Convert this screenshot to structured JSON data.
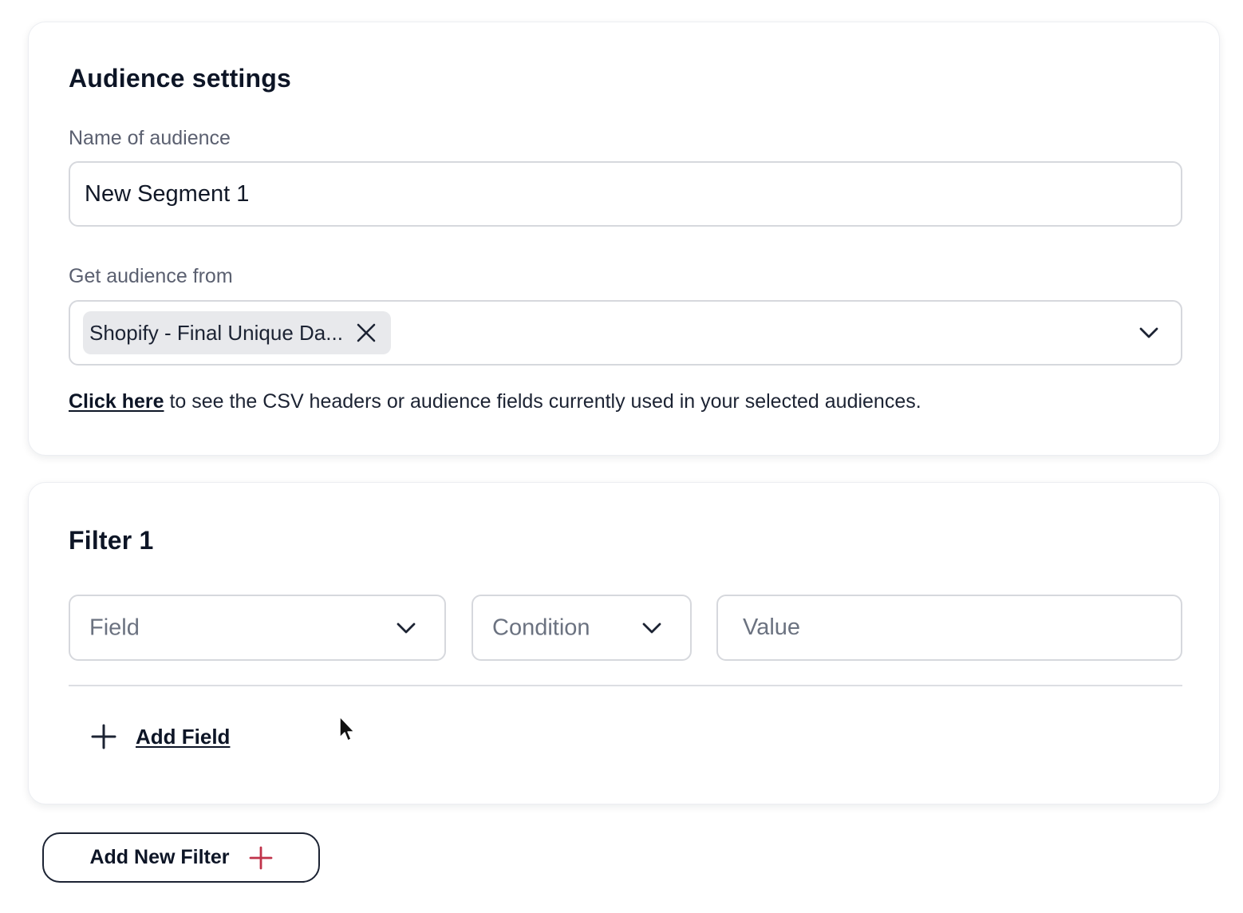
{
  "audience_settings": {
    "title": "Audience settings",
    "name_label": "Name of audience",
    "name_value": "New Segment 1",
    "source_label": "Get audience from",
    "source_chip": "Shopify - Final Unique Da...",
    "source_chip_remove_icon": "close-icon",
    "source_dropdown_icon": "chevron-down-icon",
    "help_link": "Click here",
    "help_text": " to see the CSV headers or audience fields currently used in your selected audiences."
  },
  "filter_1": {
    "title": "Filter 1",
    "field_placeholder": "Field",
    "condition_placeholder": "Condition",
    "value_placeholder": "Value",
    "add_field_label": "Add Field",
    "add_field_icon": "plus-icon"
  },
  "add_new_filter": {
    "label": "Add New Filter",
    "icon": "plus-icon",
    "icon_color": "#c0324a"
  }
}
